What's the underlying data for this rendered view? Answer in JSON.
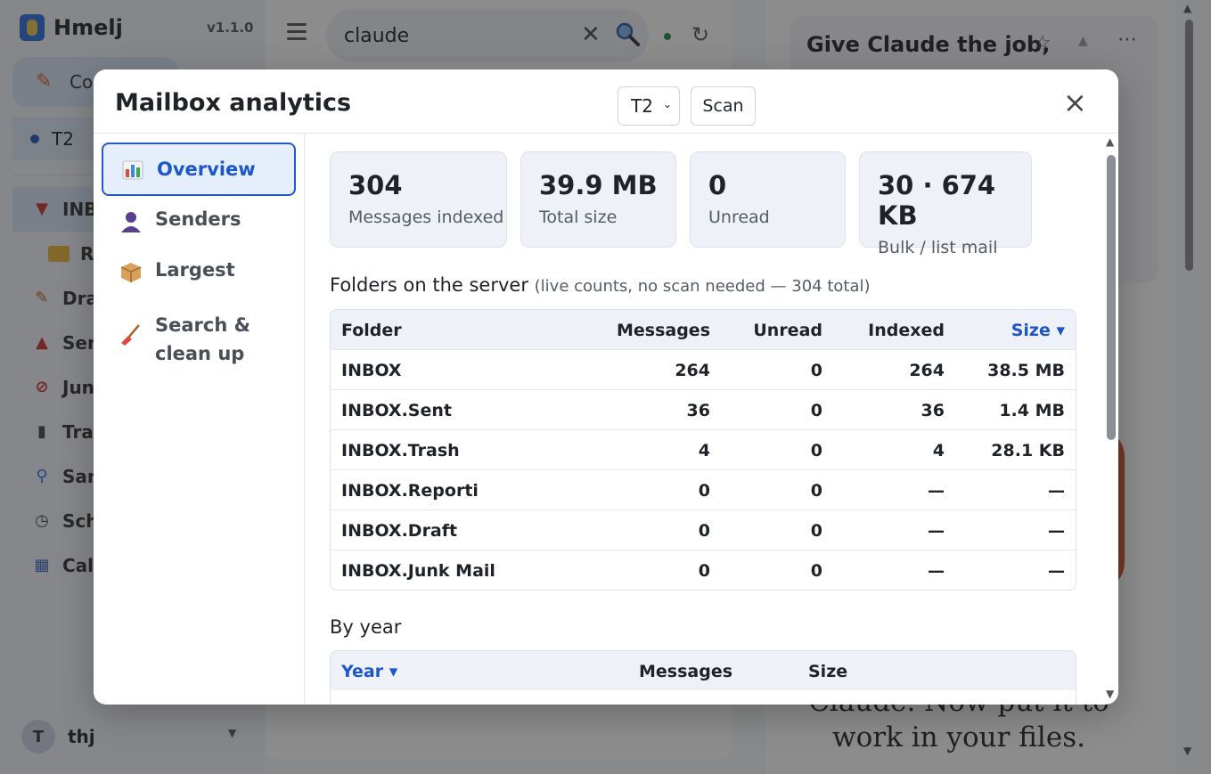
{
  "app": {
    "brand_name": "Hmelj",
    "version": "v1.1.0",
    "compose_label": "Co",
    "account": "T2",
    "nav": [
      {
        "label": "INBO",
        "icon": "inbox-icon"
      },
      {
        "label": "Re",
        "icon": "folder-icon"
      },
      {
        "label": "Draf",
        "icon": "draft-icon"
      },
      {
        "label": "Sen",
        "icon": "sent-icon"
      },
      {
        "label": "Junk",
        "icon": "junk-icon"
      },
      {
        "label": "Tras",
        "icon": "trash-icon"
      },
      {
        "label": "San",
        "icon": "search-icon"
      },
      {
        "label": "Sch",
        "icon": "clock-icon"
      },
      {
        "label": "Cale",
        "icon": "calendar-icon"
      }
    ],
    "user_initial": "T",
    "user_name": "thj"
  },
  "search": {
    "value": "claude"
  },
  "promo": {
    "title": "Give Claude the job,",
    "body": "Claude. Now put it to work in your files."
  },
  "modal": {
    "title": "Mailbox analytics",
    "account_select": "T2",
    "scan_label": "Scan",
    "nav": [
      {
        "label": "Overview",
        "icon": "bar-chart-icon",
        "active": true
      },
      {
        "label": "Senders",
        "icon": "person-icon",
        "active": false
      },
      {
        "label": "Largest",
        "icon": "package-icon",
        "active": false
      },
      {
        "label": "Search & clean up",
        "line1": "Search &",
        "line2": "clean up",
        "icon": "broom-icon",
        "active": false
      }
    ],
    "stats": [
      {
        "value": "304",
        "label": "Messages indexed"
      },
      {
        "value": "39.9 MB",
        "label": "Total size"
      },
      {
        "value": "0",
        "label": "Unread"
      },
      {
        "value": "30 · 674 KB",
        "label": "Bulk / list mail"
      }
    ],
    "folders_title": "Folders on the server",
    "folders_note": "(live counts, no scan needed — 304 total)",
    "folders_columns": {
      "folder": "Folder",
      "messages": "Messages",
      "unread": "Unread",
      "indexed": "Indexed",
      "size": "Size ▾"
    },
    "folders": [
      {
        "folder": "INBOX",
        "messages": "264",
        "unread": "0",
        "indexed": "264",
        "size": "38.5 MB"
      },
      {
        "folder": "INBOX.Sent",
        "messages": "36",
        "unread": "0",
        "indexed": "36",
        "size": "1.4 MB"
      },
      {
        "folder": "INBOX.Trash",
        "messages": "4",
        "unread": "0",
        "indexed": "4",
        "size": "28.1 KB"
      },
      {
        "folder": "INBOX.Reporti",
        "messages": "0",
        "unread": "0",
        "indexed": "—",
        "size": "—"
      },
      {
        "folder": "INBOX.Draft",
        "messages": "0",
        "unread": "0",
        "indexed": "—",
        "size": "—"
      },
      {
        "folder": "INBOX.Junk Mail",
        "messages": "0",
        "unread": "0",
        "indexed": "—",
        "size": "—"
      }
    ],
    "by_year_title": "By year",
    "year_columns": {
      "year": "Year ▾",
      "messages": "Messages",
      "size": "Size"
    }
  },
  "colors": {
    "accent": "#1d56c9",
    "card_bg": "#eef2f8",
    "overlay": "rgba(30,30,30,0.5)",
    "promo_orange": "#c8552e"
  }
}
